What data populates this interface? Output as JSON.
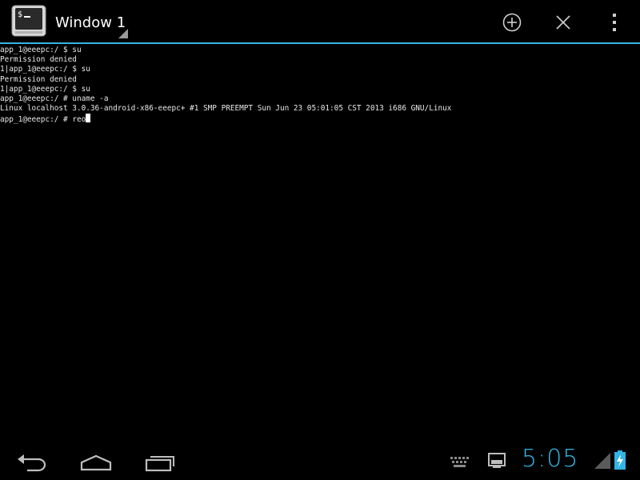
{
  "actionbar": {
    "title": "Window 1",
    "app_icon": "terminal-icon",
    "accent_color": "#33b5e5",
    "buttons": [
      {
        "name": "new-window-button",
        "icon": "plus-circle-icon"
      },
      {
        "name": "close-window-button",
        "icon": "close-icon"
      },
      {
        "name": "overflow-menu-button",
        "icon": "overflow-dots-icon"
      }
    ]
  },
  "terminal": {
    "lines": [
      "app_1@eeepc:/ $ su",
      "Permission denied",
      "1|app_1@eeepc:/ $ su",
      "Permission denied",
      "1|app_1@eeepc:/ $ su",
      "app_1@eeepc:/ # uname -a",
      "Linux localhost 3.0.36-android-x86-eeepc+ #1 SMP PREEMPT Sun Jun 23 05:01:05 CST 2013 i686 GNU/Linux"
    ],
    "prompt": "app_1@eeepc:/ # ",
    "input": "reo"
  },
  "sysbar": {
    "clock": "5:05",
    "nav": [
      "back-icon",
      "home-icon",
      "recent-apps-icon"
    ],
    "status_icons": [
      "keyboard-icon",
      "screen-notification-icon",
      "signal-icon",
      "battery-charging-icon"
    ]
  }
}
